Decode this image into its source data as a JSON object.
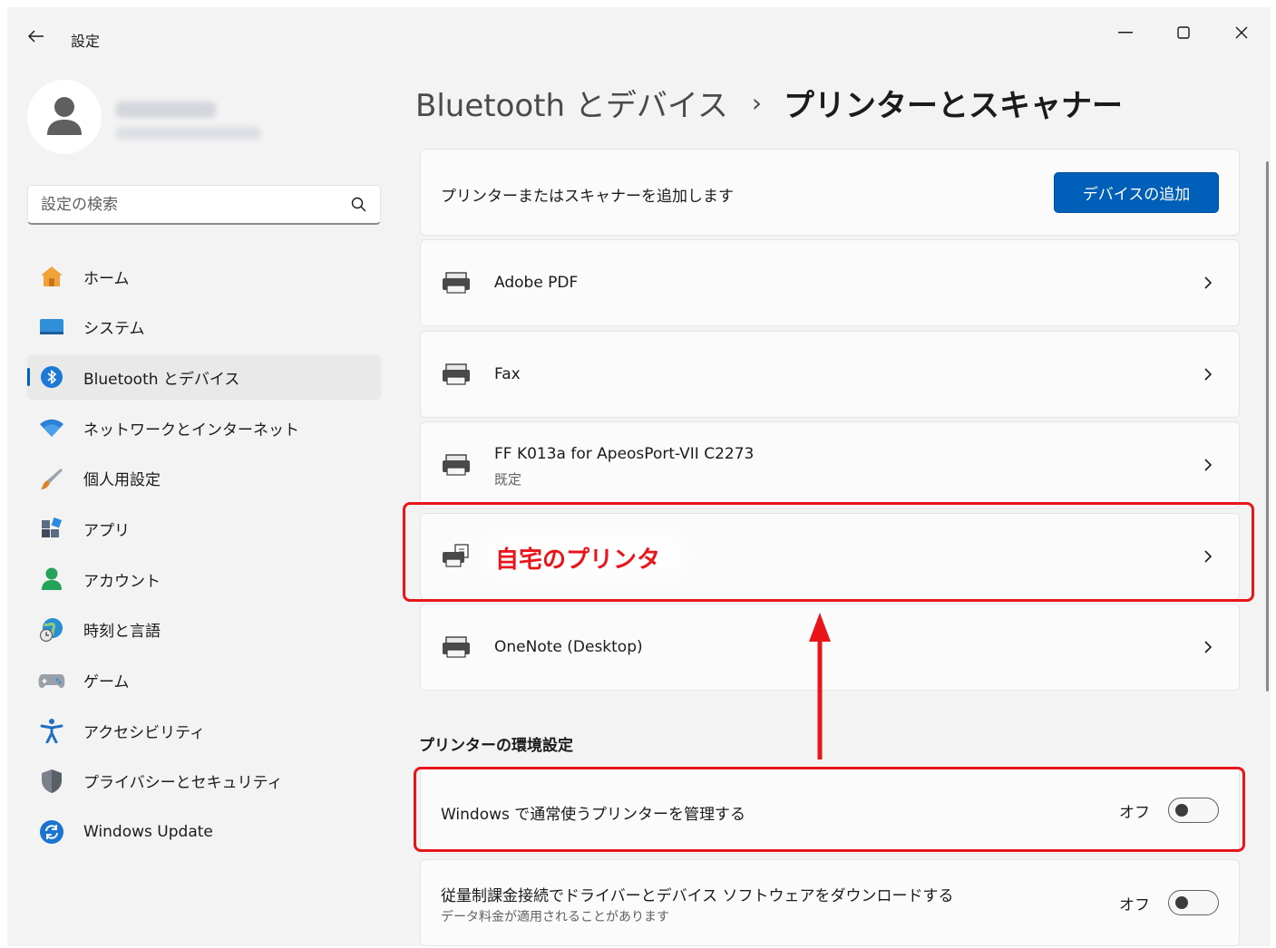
{
  "window": {
    "title": "設定",
    "controls": [
      "minimize-icon",
      "maximize-icon",
      "close-icon"
    ]
  },
  "sidebar": {
    "search_placeholder": "設定の検索",
    "items": [
      {
        "label": "ホーム",
        "icon": "home-icon",
        "color": "#f1a33a"
      },
      {
        "label": "システム",
        "icon": "system-icon",
        "color": "#2f8fd8"
      },
      {
        "label": "Bluetooth とデバイス",
        "icon": "bluetooth-icon",
        "color": "#1e78d6",
        "selected": true
      },
      {
        "label": "ネットワークとインターネット",
        "icon": "wifi-icon",
        "color": "#2b7fd4"
      },
      {
        "label": "個人用設定",
        "icon": "brush-icon",
        "color": "#d9822b"
      },
      {
        "label": "アプリ",
        "icon": "apps-icon",
        "color": "#5a6b82"
      },
      {
        "label": "アカウント",
        "icon": "account-icon",
        "color": "#23a35a"
      },
      {
        "label": "時刻と言語",
        "icon": "globe-clock-icon",
        "color": "#2a8ed6"
      },
      {
        "label": "ゲーム",
        "icon": "gamepad-icon",
        "color": "#8a8f98"
      },
      {
        "label": "アクセシビリティ",
        "icon": "accessibility-icon",
        "color": "#1f6fc2"
      },
      {
        "label": "プライバシーとセキュリティ",
        "icon": "shield-icon",
        "color": "#6b7280"
      },
      {
        "label": "Windows Update",
        "icon": "update-icon",
        "color": "#1b74d1"
      }
    ]
  },
  "breadcrumb": {
    "parent": "Bluetooth とデバイス",
    "separator": "›",
    "current": "プリンターとスキャナー"
  },
  "add_row": {
    "label": "プリンターまたはスキャナーを追加します",
    "button": "デバイスの追加"
  },
  "devices": [
    {
      "name": "Adobe PDF",
      "icon": "printer-icon"
    },
    {
      "name": "Fax",
      "icon": "printer-icon"
    },
    {
      "name": "FF K013a for ApeosPort-VII C2273",
      "status": "既定",
      "icon": "printer-icon"
    },
    {
      "name": "自宅のプリンタ",
      "icon": "network-printer-icon",
      "highlighted": true
    },
    {
      "name": "OneNote (Desktop)",
      "icon": "printer-icon"
    }
  ],
  "preferences": {
    "title": "プリンターの環境設定",
    "settings": [
      {
        "label": "Windows で通常使うプリンターを管理する",
        "state": "オフ",
        "on": false
      },
      {
        "label": "従量制課金接続でドライバーとデバイス ソフトウェアをダウンロードする",
        "description": "データ料金が適用されることがあります",
        "state": "オフ",
        "on": false
      }
    ]
  },
  "colors": {
    "accent": "#005fb8",
    "annotation": "#e8151b",
    "background": "#f3f3f3",
    "card": "#fbfbfb"
  }
}
